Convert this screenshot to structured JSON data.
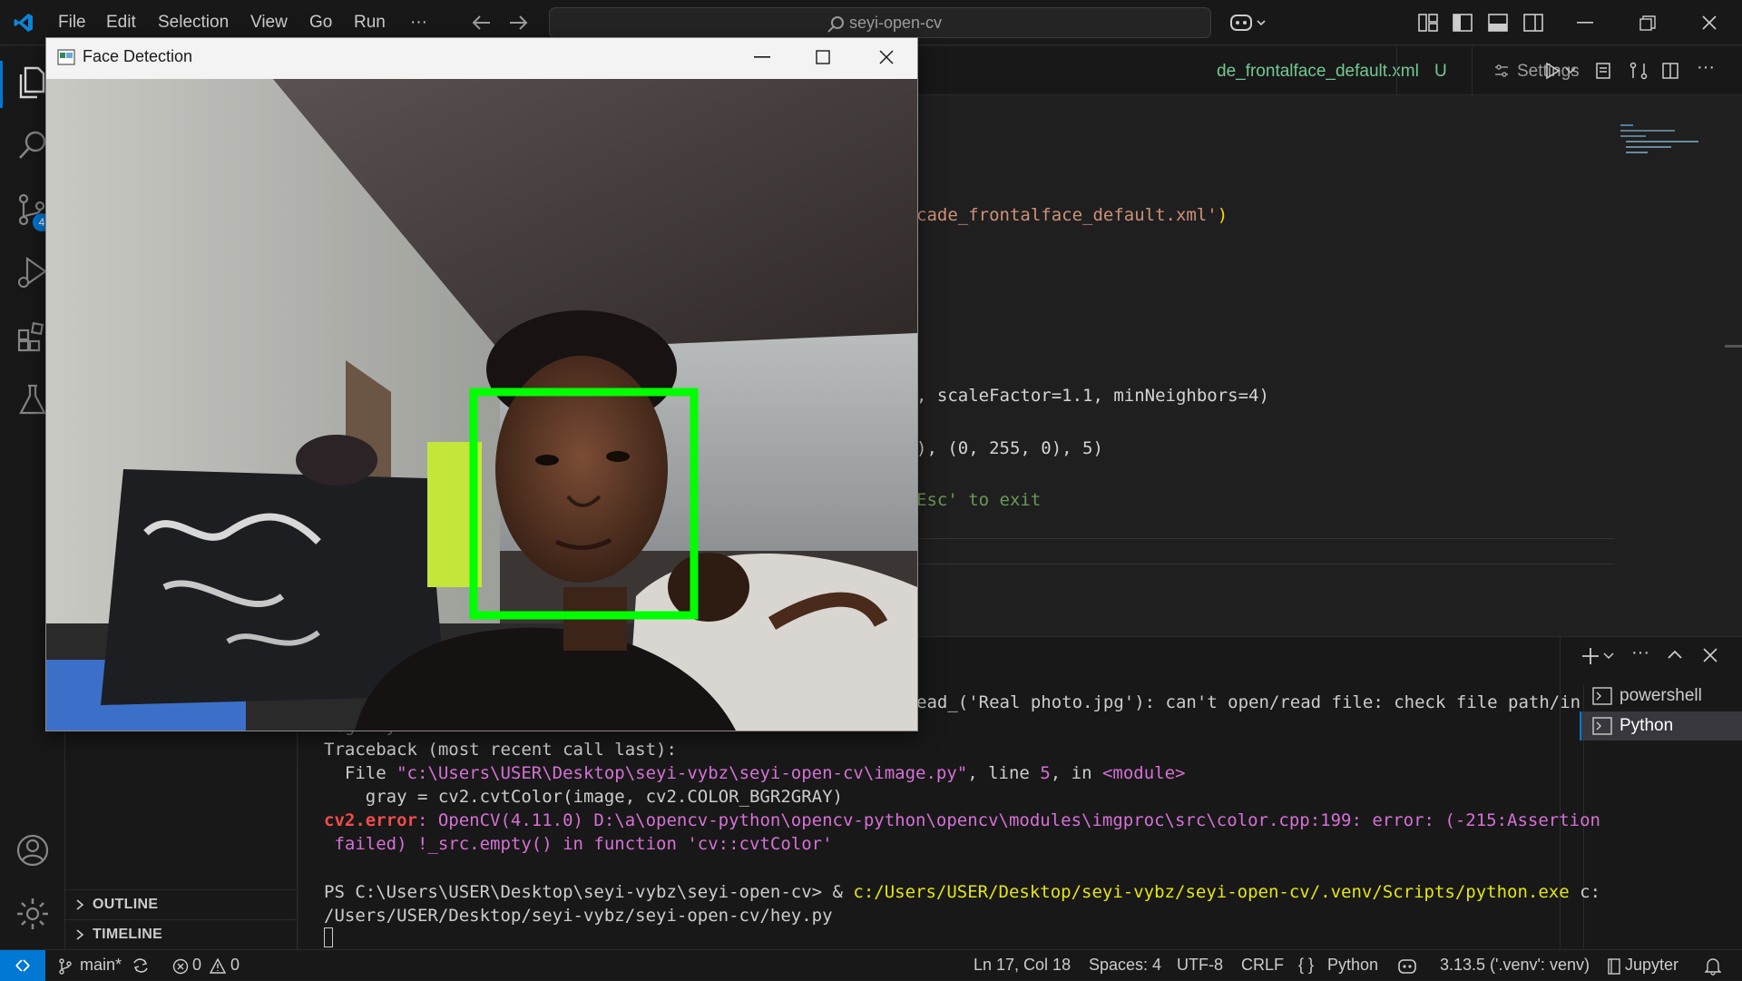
{
  "menu": [
    "File",
    "Edit",
    "Selection",
    "View",
    "Go",
    "Run",
    "···"
  ],
  "search": {
    "text": "seyi-open-cv"
  },
  "tabs": [
    {
      "label": "de_frontalface_default.xml",
      "badge": "U"
    },
    {
      "label": "Settings"
    }
  ],
  "source_control_badge": "4",
  "editor_lines": [
    {
      "plain": "",
      "str": "cade_frontalface_default.xml'",
      "tail": ")"
    },
    {
      "text": ", scaleFactor=1.1, minNeighbors=4)"
    },
    {
      "text": "), (0, 255, 0), 5)"
    },
    {
      "comment": "Esc' to exit"
    }
  ],
  "sidebar": {
    "outline": "OUTLINE",
    "timeline": "TIMELINE"
  },
  "terminal": {
    "line1": "ead_('Real photo.jpg'): can't open/read file: check file path/in",
    "line1b": "tegrity",
    "traceback": "Traceback (most recent call last):",
    "file_prefix": "  File ",
    "file_path": "\"c:\\Users\\USER\\Desktop\\seyi-vybz\\seyi-open-cv\\image.py\"",
    "file_mid": ", line ",
    "file_line": "5",
    "file_in": ", in ",
    "file_module": "<module>",
    "code_line": "    gray = cv2.cvtColor(image, cv2.COLOR_BGR2GRAY)",
    "error_name": "cv2.error",
    "error_msg": ": OpenCV(4.11.0) D:\\a\\opencv-python\\opencv-python\\opencv\\modules\\imgproc\\src\\color.cpp:199: error: (-215:Assertion",
    "error_msg2": " failed) !_src.empty() in function 'cv::cvtColor'",
    "prompt": "PS C:\\Users\\USER\\Desktop\\seyi-vybz\\seyi-open-cv> & ",
    "cmd": "c:/Users/USER/Desktop/seyi-vybz/seyi-open-cv/.venv/Scripts/python.exe",
    "cmd_tail": " c:",
    "cmd2": "/Users/USER/Desktop/seyi-vybz/seyi-open-cv/hey.py",
    "sessions": [
      "powershell",
      "Python"
    ]
  },
  "statusbar": {
    "branch": "main*",
    "errors": "0",
    "warnings": "0",
    "position": "Ln 17, Col 18",
    "spaces": "Spaces: 4",
    "encoding": "UTF-8",
    "eol": "CRLF",
    "language": "Python",
    "interpreter": "3.13.5 ('.venv': venv)",
    "jupyter": "Jupyter"
  },
  "window": {
    "title": "Face Detection"
  },
  "colors": {
    "accent": "#0078d4",
    "detection_box": "#00ff00",
    "string": "#ce9178",
    "error": "#f14c4c",
    "magenta": "#d670d6",
    "yellow": "#e5e510"
  }
}
